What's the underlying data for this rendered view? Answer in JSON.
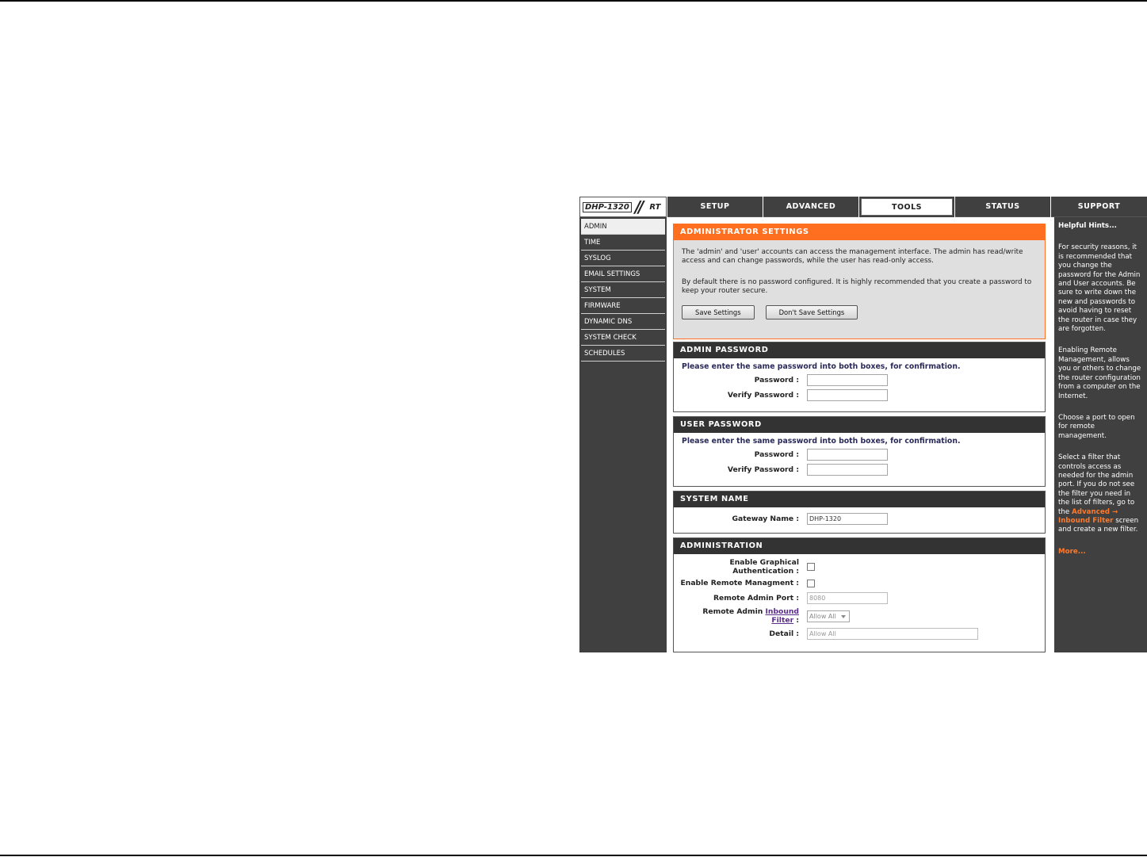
{
  "logo": {
    "model": "DHP-1320",
    "slashes": "//",
    "suffix": "RT"
  },
  "tabs": [
    {
      "label": "SETUP"
    },
    {
      "label": "ADVANCED"
    },
    {
      "label": "TOOLS"
    },
    {
      "label": "STATUS"
    },
    {
      "label": "SUPPORT"
    }
  ],
  "active_tab": "TOOLS",
  "sidebar": {
    "active": "ADMIN",
    "items": [
      {
        "label": "ADMIN"
      },
      {
        "label": "TIME"
      },
      {
        "label": "SYSLOG"
      },
      {
        "label": "EMAIL SETTINGS"
      },
      {
        "label": "SYSTEM"
      },
      {
        "label": "FIRMWARE"
      },
      {
        "label": "DYNAMIC DNS"
      },
      {
        "label": "SYSTEM CHECK"
      },
      {
        "label": "SCHEDULES"
      }
    ]
  },
  "admin_settings": {
    "title": "ADMINISTRATOR SETTINGS",
    "para1": "The 'admin' and 'user' accounts can access the management interface. The admin has read/write access and can change passwords, while the user has read-only access.",
    "para2": "By default there is no password configured. It is highly recommended that you create a password to keep your router secure.",
    "save_label": "Save Settings",
    "dont_save_label": "Don't Save Settings"
  },
  "admin_password": {
    "title": "ADMIN PASSWORD",
    "instruction": "Please enter the same password into both boxes, for confirmation.",
    "password_label": "Password :",
    "password_value": "",
    "verify_label": "Verify Password :",
    "verify_value": ""
  },
  "user_password": {
    "title": "USER PASSWORD",
    "instruction": "Please enter the same password into both boxes, for confirmation.",
    "password_label": "Password :",
    "password_value": "",
    "verify_label": "Verify Password :",
    "verify_value": ""
  },
  "system_name": {
    "title": "SYSTEM NAME",
    "gateway_label": "Gateway Name :",
    "gateway_value": "DHP-1320"
  },
  "administration": {
    "title": "ADMINISTRATION",
    "graphical_auth_label_1": "Enable Graphical",
    "graphical_auth_label_2": "Authentication :",
    "graphical_auth_checked": false,
    "remote_mgmt_label": "Enable Remote Managment :",
    "remote_mgmt_checked": false,
    "port_label": "Remote Admin Port :",
    "port_value": "8080",
    "filter_label_prefix": "Remote Admin",
    "filter_link_1": "Inbound",
    "filter_link_2": "Filter",
    "filter_colon": ":",
    "filter_value": "Allow All",
    "detail_label": "Detail :",
    "detail_value": "Allow All"
  },
  "hints": {
    "title": "Helpful Hints...",
    "hint1": "For security reasons, it is recommended that you change the password for the Admin and User accounts. Be sure to write down the new and passwords to avoid having to reset the router in case they are forgotten.",
    "hint2": "Enabling Remote Management, allows you or others to change the router configuration from a computer on the Internet.",
    "hint3": "Choose a port to open for remote management.",
    "hint4_before": "Select a filter that controls access as needed for the admin port. If you do not see the filter you need in the list of filters, go to the",
    "hint4_link": "Advanced → Inbound Filter",
    "hint4_after": "screen and create a new filter.",
    "more": "More..."
  }
}
